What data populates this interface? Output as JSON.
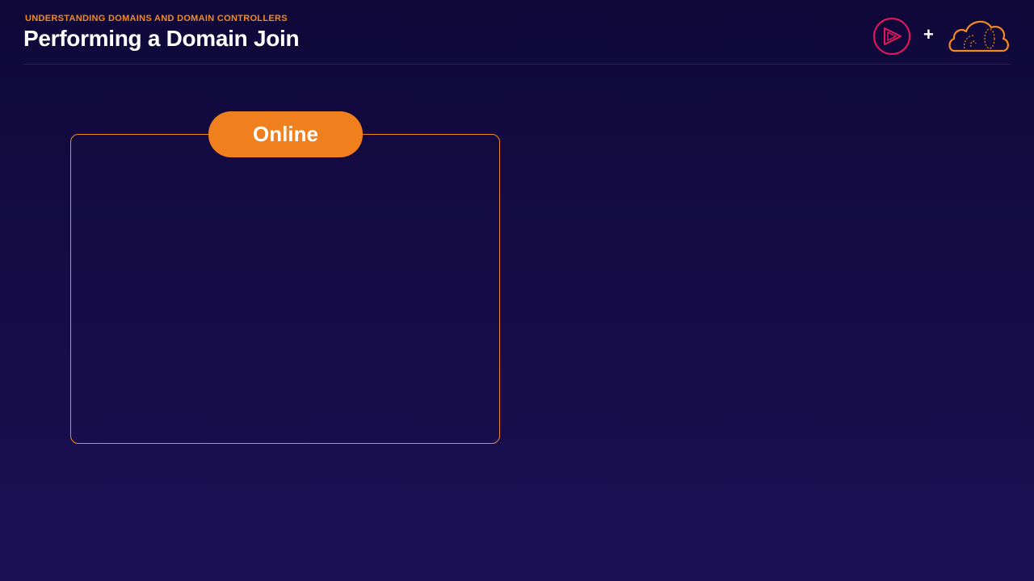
{
  "header": {
    "eyebrow": "UNDERSTANDING DOMAINS AND DOMAIN CONTROLLERS",
    "title": "Performing a Domain Join"
  },
  "logos": {
    "left_icon": "play-logo-icon",
    "separator": "+",
    "right_icon": "cloud-logo-icon"
  },
  "panel": {
    "tab_label": "Online"
  },
  "colors": {
    "accent_orange": "#f07f1e",
    "logo_pink": "#e8175d",
    "background_top": "#0f0838",
    "background_bottom": "#1b1053",
    "title_text": "#ffffff"
  }
}
